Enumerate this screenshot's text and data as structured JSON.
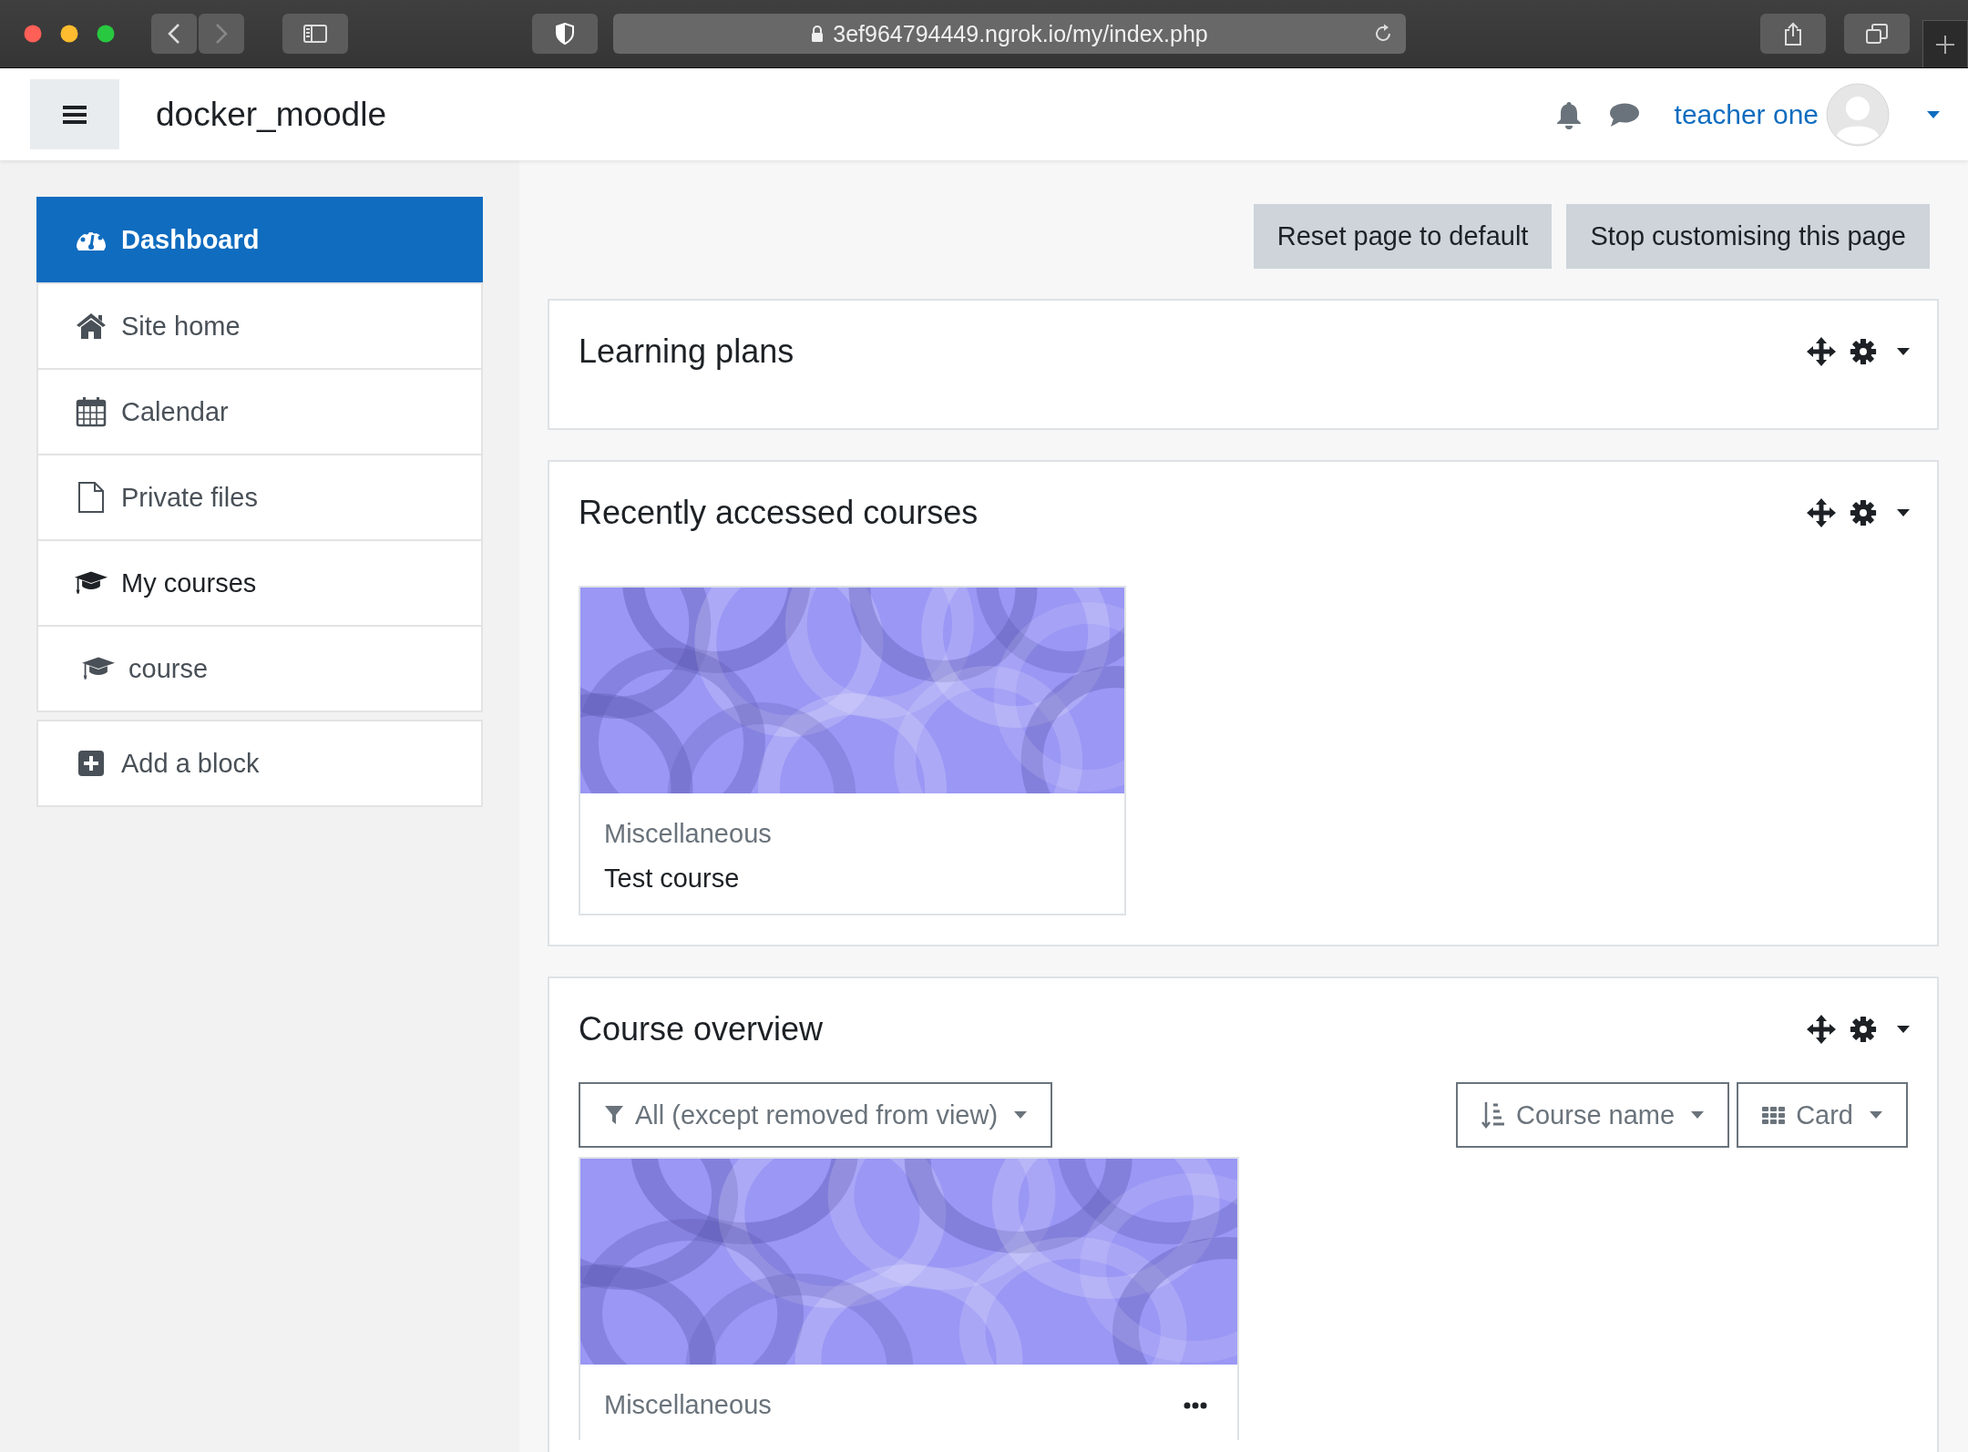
{
  "browser": {
    "url": "3ef964794449.ngrok.io/my/index.php"
  },
  "navbar": {
    "site_name": "docker_moodle",
    "user_name": "teacher one"
  },
  "sidebar": {
    "items": [
      {
        "label": "Dashboard",
        "selected": true
      },
      {
        "label": "Site home",
        "selected": false
      },
      {
        "label": "Calendar",
        "selected": false
      },
      {
        "label": "Private files",
        "selected": false
      },
      {
        "label": "My courses",
        "selected": false
      },
      {
        "label": "course",
        "selected": false
      }
    ],
    "add_block": "Add a block"
  },
  "page_buttons": [
    "Reset page to default",
    "Stop customising this page"
  ],
  "blocks": [
    {
      "kind": "plain",
      "title": "Learning plans"
    },
    {
      "kind": "recent",
      "title": "Recently accessed courses",
      "courses": [
        {
          "category": "Miscellaneous",
          "name": "Test course"
        }
      ]
    },
    {
      "kind": "overview",
      "title": "Course overview",
      "filter": "All (except removed from view)",
      "sort": "Course name",
      "view": "Card",
      "courses": [
        {
          "category": "Miscellaneous"
        }
      ]
    }
  ]
}
